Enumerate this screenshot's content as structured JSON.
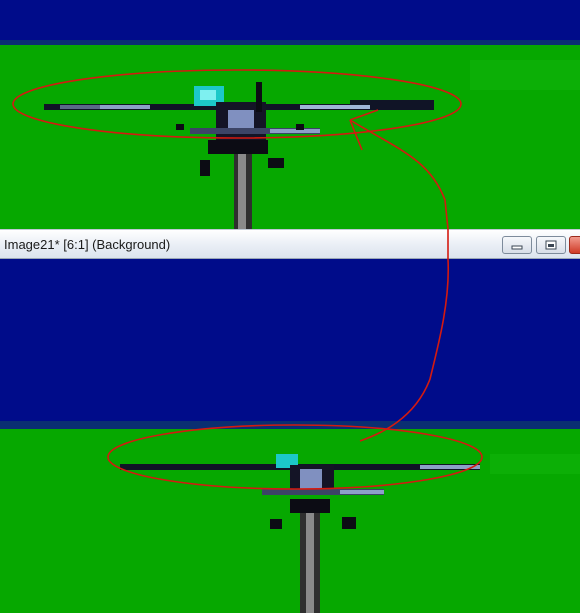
{
  "window": {
    "title": "Image21* [6:1] (Background)",
    "buttons": [
      "minimize-icon",
      "restore-icon",
      "close-icon"
    ]
  },
  "colors": {
    "sky": "#000c8a",
    "sky_edge": "#0a2b7a",
    "grass": "#06a800",
    "annotation": "#d41a10"
  }
}
